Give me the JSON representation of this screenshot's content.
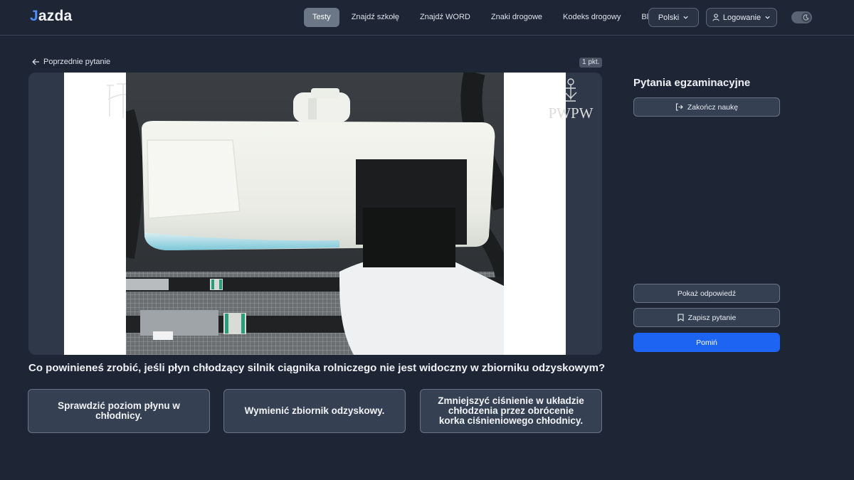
{
  "brand": {
    "logo_first": "J",
    "logo_rest": "azda"
  },
  "nav": {
    "links": [
      "Testy",
      "Znajdź szkołę",
      "Znajdź WORD",
      "Znaki drogowe",
      "Kodeks drogowy",
      "Blog"
    ],
    "active_index": 0,
    "language": "Polski",
    "login": "Logowanie",
    "theme_icon": "moon-icon"
  },
  "question_header": {
    "back_label": "Poprzednie pytanie",
    "points": "1 pkt."
  },
  "media": {
    "watermark_right_text": "PWPW",
    "watermark_left_text": "ITS"
  },
  "question": {
    "text": "Co powinieneś zrobić, jeśli płyn chłodzący silnik ciągnika rolniczego nie jest widoczny w zbiorniku odzyskowym?",
    "answers": [
      "Sprawdzić poziom płynu w chłodnicy.",
      "Wymienić zbiornik odzyskowy.",
      "Zmniejszyć ciśnienie w układzie chłodzenia przez obrócenie korka ciśnieniowego chłodnicy."
    ]
  },
  "sidebar": {
    "title": "Pytania egzaminacyjne",
    "finish_label": "Zakończ naukę",
    "show_answer_label": "Pokaż odpowiedź",
    "save_label": "Zapisz pytanie",
    "skip_label": "Pomiń"
  },
  "colors": {
    "background": "#1e2535",
    "card": "#354052",
    "accent": "#1d64f2",
    "logo_accent": "#4f8df9"
  }
}
